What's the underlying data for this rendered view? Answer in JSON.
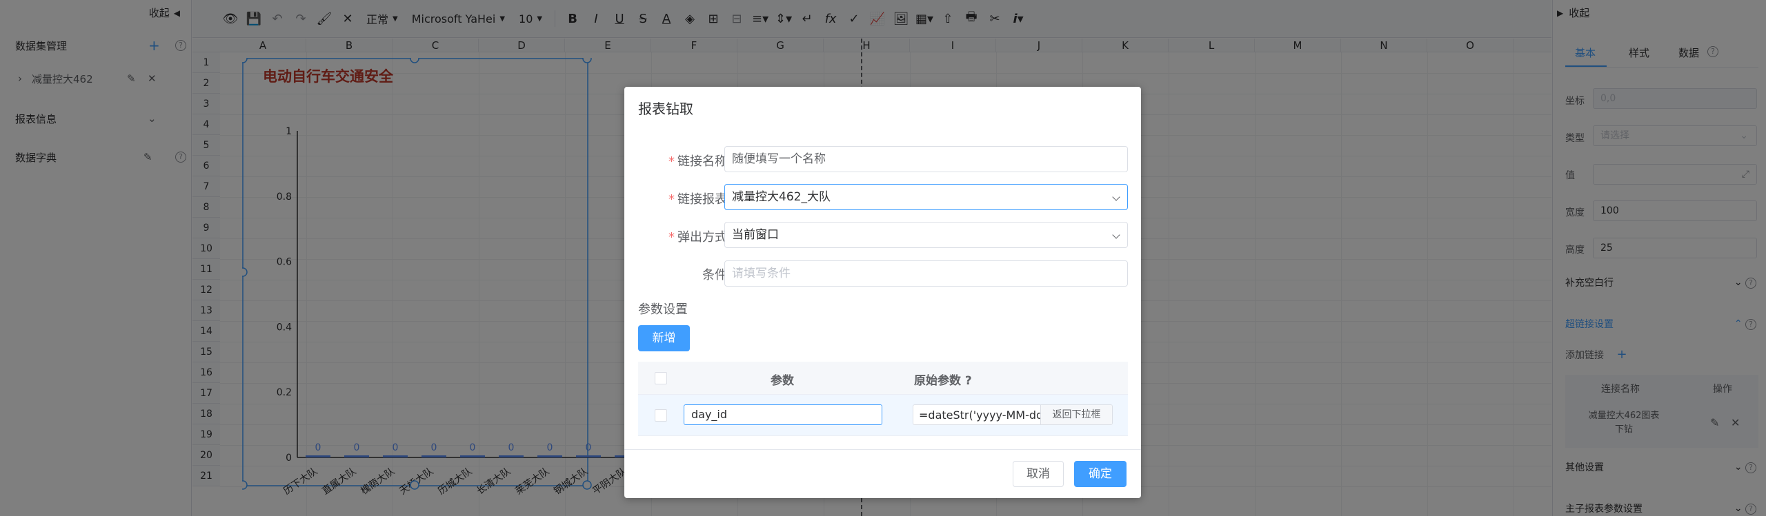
{
  "left_panel": {
    "collapse_label": "收起",
    "dataset_title": "数据集管理",
    "dataset_item": "减量控大462",
    "report_info": "报表信息",
    "dictionary": "数据字典"
  },
  "toolbar": {
    "format": "正常",
    "font": "Microsoft YaHei",
    "size": "10"
  },
  "sheet": {
    "columns": [
      "A",
      "B",
      "C",
      "D",
      "E",
      "F",
      "G",
      "H",
      "I",
      "J",
      "K",
      "L",
      "M",
      "N",
      "O"
    ],
    "rows": [
      "1",
      "2",
      "3",
      "4",
      "5",
      "6",
      "7",
      "8",
      "9",
      "10",
      "11",
      "12",
      "13",
      "14",
      "15",
      "16",
      "17",
      "18",
      "19",
      "20",
      "21"
    ],
    "chart_title": "电动自行车交通安全"
  },
  "chart_data": {
    "type": "bar",
    "title": "电动自行车交通安全",
    "categories": [
      "历下大队",
      "直属大队",
      "槐荫大队",
      "天桥大队",
      "历城大队",
      "长清大队",
      "莱芜大队",
      "钢城大队",
      "平阴大队"
    ],
    "values": [
      0,
      0,
      0,
      0,
      0,
      0,
      0,
      0,
      0
    ],
    "yticks": [
      "0",
      "0.2",
      "0.4",
      "0.6",
      "0.8",
      "1"
    ],
    "ylim": [
      0,
      1
    ]
  },
  "right_panel": {
    "collapse_label": "收起",
    "tabs": [
      "基本",
      "样式",
      "数据"
    ],
    "coord_label": "坐标",
    "coord_value": "0,0",
    "type_label": "类型",
    "type_placeholder": "请选择",
    "value_label": "值",
    "width_label": "宽度",
    "width_value": "100",
    "height_label": "高度",
    "height_value": "25",
    "fill_rows": "补充空白行",
    "hyperlink": "超链接设置",
    "add_link": "添加链接",
    "link_col": "连接名称",
    "op_col": "操作",
    "link_item": "减量控大462图表下钻",
    "other": "其他设置",
    "master": "主子报表参数设置"
  },
  "dialog": {
    "title": "报表钻取",
    "name_label": "链接名称",
    "name_value": "随便填写一个名称",
    "report_label": "链接报表",
    "report_value": "减量控大462_大队",
    "popup_label": "弹出方式",
    "popup_value": "当前窗口",
    "cond_label": "条件",
    "cond_placeholder": "请填写条件",
    "param_section": "参数设置",
    "add_button": "新增",
    "param_header": "参数",
    "orig_header": "原始参数 ?",
    "param_value": "day_id",
    "orig_value": "=dateStr('yyyy-MM-dd'",
    "dropdown_back": "返回下拉框",
    "cancel": "取消",
    "ok": "确定"
  },
  "colors": {
    "primary": "#409eff",
    "required": "#f56c6c",
    "chart_title": "#c0392b"
  }
}
